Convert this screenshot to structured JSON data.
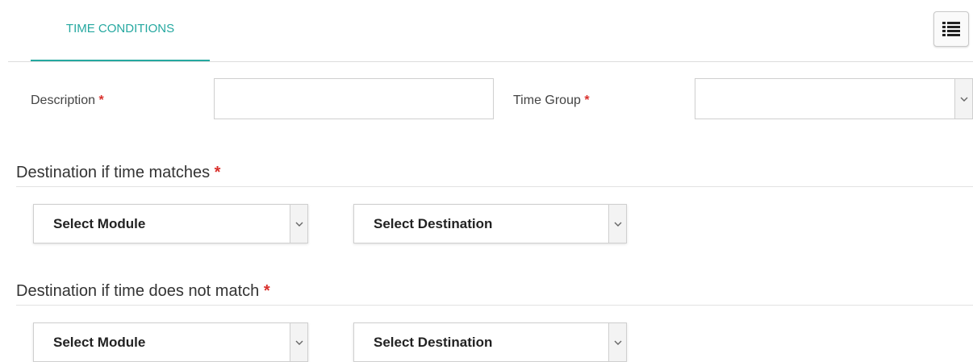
{
  "tabs": [
    {
      "label": "TIME CONDITIONS",
      "active": true
    }
  ],
  "toolbar": {
    "list_icon": "list-icon"
  },
  "form": {
    "description": {
      "label": "Description",
      "required_mark": "*",
      "value": ""
    },
    "time_group": {
      "label": "Time Group",
      "required_mark": "*",
      "selected": ""
    }
  },
  "sections": {
    "matches": {
      "title": "Destination if time matches",
      "required_mark": "*",
      "module": "Select Module",
      "destination": "Select Destination"
    },
    "not_match": {
      "title": "Destination if time does not match",
      "required_mark": "*",
      "module": "Select Module",
      "destination": "Select Destination"
    }
  },
  "colors": {
    "accent": "#25a8a0",
    "required": "#d9302c"
  }
}
